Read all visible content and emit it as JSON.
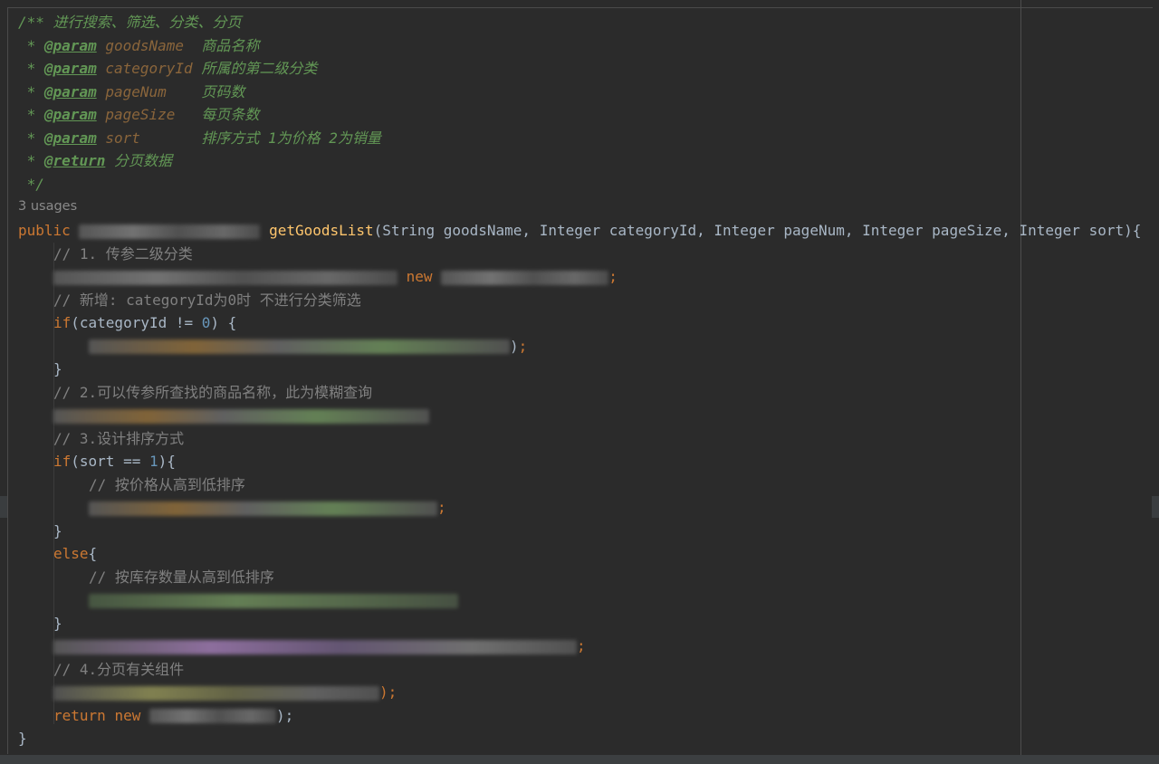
{
  "doc_comment": {
    "open": "/** ",
    "title": "进行搜索、筛选、分类、分页",
    "star": " * ",
    "params": [
      {
        "tag": "@param",
        "name": "goodsName",
        "pad": "  ",
        "desc": "商品名称"
      },
      {
        "tag": "@param",
        "name": "categoryId",
        "pad": " ",
        "desc": "所属的第二级分类"
      },
      {
        "tag": "@param",
        "name": "pageNum",
        "pad": "    ",
        "desc": "页码数"
      },
      {
        "tag": "@param",
        "name": "pageSize",
        "pad": "   ",
        "desc": "每页条数"
      },
      {
        "tag": "@param",
        "name": "sort",
        "pad": "       ",
        "desc": "排序方式 1为价格 2为销量"
      }
    ],
    "return_tag": "@return",
    "return_desc": "分页数据",
    "close": " */"
  },
  "usages": "3 usages",
  "signature": {
    "modifier": "public",
    "method": "getGoodsList",
    "params_text": "(String goodsName, Integer categoryId, Integer pageNum, Integer pageSize, Integer sort){"
  },
  "comments": {
    "c1": "// 1. 传参二级分类",
    "c_new": "// 新增: categoryId为0时 不进行分类筛选",
    "c2": "// 2.可以传参所查找的商品名称，此为模糊查询",
    "c3": "// 3.设计排序方式",
    "c_price": "// 按价格从高到低排序",
    "c_stock": "// 按库存数量从高到低排序",
    "c4": "// 4.分页有关组件"
  },
  "code": {
    "if_kw": "if",
    "if_cond1": "(categoryId != ",
    "zero": "0",
    "if_close1": ") {",
    "close_brace": "}",
    "if_cond2": "(sort == ",
    "one": "1",
    "if_close2": "){",
    "else_kw": "else",
    "else_open": "{",
    "return_kw": "return",
    "new_kw": "new",
    "semicolon": ";",
    "new_mid": "new",
    "paren_semi": ");"
  }
}
